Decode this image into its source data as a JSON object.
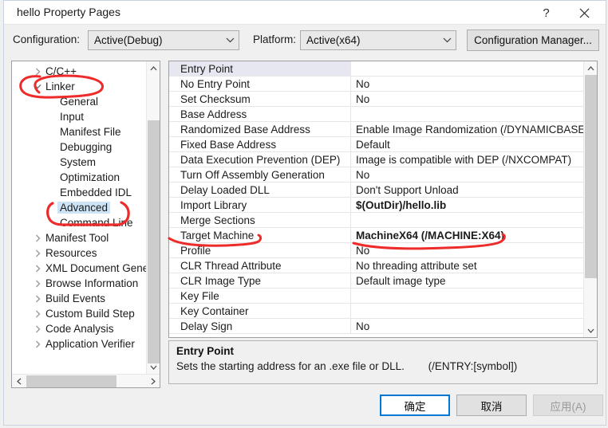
{
  "window": {
    "title": "hello Property Pages",
    "help_label": "?",
    "close_label": "×"
  },
  "config_bar": {
    "configuration_label": "Configuration:",
    "configuration_value": "Active(Debug)",
    "platform_label": "Platform:",
    "platform_value": "Active(x64)",
    "configuration_manager_label": "Configuration Manager..."
  },
  "tree": {
    "selected": "Advanced",
    "items": [
      {
        "label": "C/C++",
        "indent": 1,
        "chevron": "collapsed"
      },
      {
        "label": "Linker",
        "indent": 1,
        "chevron": "expanded"
      },
      {
        "label": "General",
        "indent": 2,
        "chevron": "none"
      },
      {
        "label": "Input",
        "indent": 2,
        "chevron": "none"
      },
      {
        "label": "Manifest File",
        "indent": 2,
        "chevron": "none"
      },
      {
        "label": "Debugging",
        "indent": 2,
        "chevron": "none"
      },
      {
        "label": "System",
        "indent": 2,
        "chevron": "none"
      },
      {
        "label": "Optimization",
        "indent": 2,
        "chevron": "none"
      },
      {
        "label": "Embedded IDL",
        "indent": 2,
        "chevron": "none"
      },
      {
        "label": "Advanced",
        "indent": 2,
        "chevron": "none"
      },
      {
        "label": "Command Line",
        "indent": 2,
        "chevron": "none"
      },
      {
        "label": "Manifest Tool",
        "indent": 1,
        "chevron": "collapsed"
      },
      {
        "label": "Resources",
        "indent": 1,
        "chevron": "collapsed"
      },
      {
        "label": "XML Document Gene",
        "indent": 1,
        "chevron": "collapsed"
      },
      {
        "label": "Browse Information",
        "indent": 1,
        "chevron": "collapsed"
      },
      {
        "label": "Build Events",
        "indent": 1,
        "chevron": "collapsed"
      },
      {
        "label": "Custom Build Step",
        "indent": 1,
        "chevron": "collapsed"
      },
      {
        "label": "Code Analysis",
        "indent": 1,
        "chevron": "collapsed"
      },
      {
        "label": "Application Verifier",
        "indent": 1,
        "chevron": "collapsed"
      }
    ]
  },
  "property_grid": {
    "selected_row": "Entry Point",
    "rows": [
      {
        "name": "Entry Point",
        "value": "",
        "bold": false,
        "selected": true
      },
      {
        "name": "No Entry Point",
        "value": "No",
        "bold": false,
        "selected": false
      },
      {
        "name": "Set Checksum",
        "value": "No",
        "bold": false,
        "selected": false
      },
      {
        "name": "Base Address",
        "value": "",
        "bold": false,
        "selected": false
      },
      {
        "name": "Randomized Base Address",
        "value": "Enable Image Randomization (/DYNAMICBASE)",
        "bold": false,
        "selected": false
      },
      {
        "name": "Fixed Base Address",
        "value": "Default",
        "bold": false,
        "selected": false
      },
      {
        "name": "Data Execution Prevention (DEP)",
        "value": "Image is compatible with DEP (/NXCOMPAT)",
        "bold": false,
        "selected": false
      },
      {
        "name": "Turn Off Assembly Generation",
        "value": "No",
        "bold": false,
        "selected": false
      },
      {
        "name": "Delay Loaded DLL",
        "value": "Don't Support Unload",
        "bold": false,
        "selected": false
      },
      {
        "name": "Import Library",
        "value": "$(OutDir)/hello.lib",
        "bold": true,
        "selected": false
      },
      {
        "name": "Merge Sections",
        "value": "",
        "bold": false,
        "selected": false
      },
      {
        "name": "Target Machine",
        "value": "MachineX64 (/MACHINE:X64)",
        "bold": true,
        "selected": false
      },
      {
        "name": "Profile",
        "value": "No",
        "bold": false,
        "selected": false
      },
      {
        "name": "CLR Thread Attribute",
        "value": "No threading attribute set",
        "bold": false,
        "selected": false
      },
      {
        "name": "CLR Image Type",
        "value": "Default image type",
        "bold": false,
        "selected": false
      },
      {
        "name": "Key File",
        "value": "",
        "bold": false,
        "selected": false
      },
      {
        "name": "Key Container",
        "value": "",
        "bold": false,
        "selected": false
      },
      {
        "name": "Delay Sign",
        "value": "No",
        "bold": false,
        "selected": false
      }
    ]
  },
  "description": {
    "title": "Entry Point",
    "text": "Sets the starting address for an .exe file or DLL.",
    "switch": "(/ENTRY:[symbol])"
  },
  "buttons": {
    "ok": "确定",
    "cancel": "取消",
    "apply": "应用(A)"
  },
  "annotations": {
    "color": "#ee2b2b",
    "marks": [
      "circle-linker",
      "bracket-advanced",
      "underline-target-machine-name",
      "underline-target-machine-value"
    ]
  }
}
